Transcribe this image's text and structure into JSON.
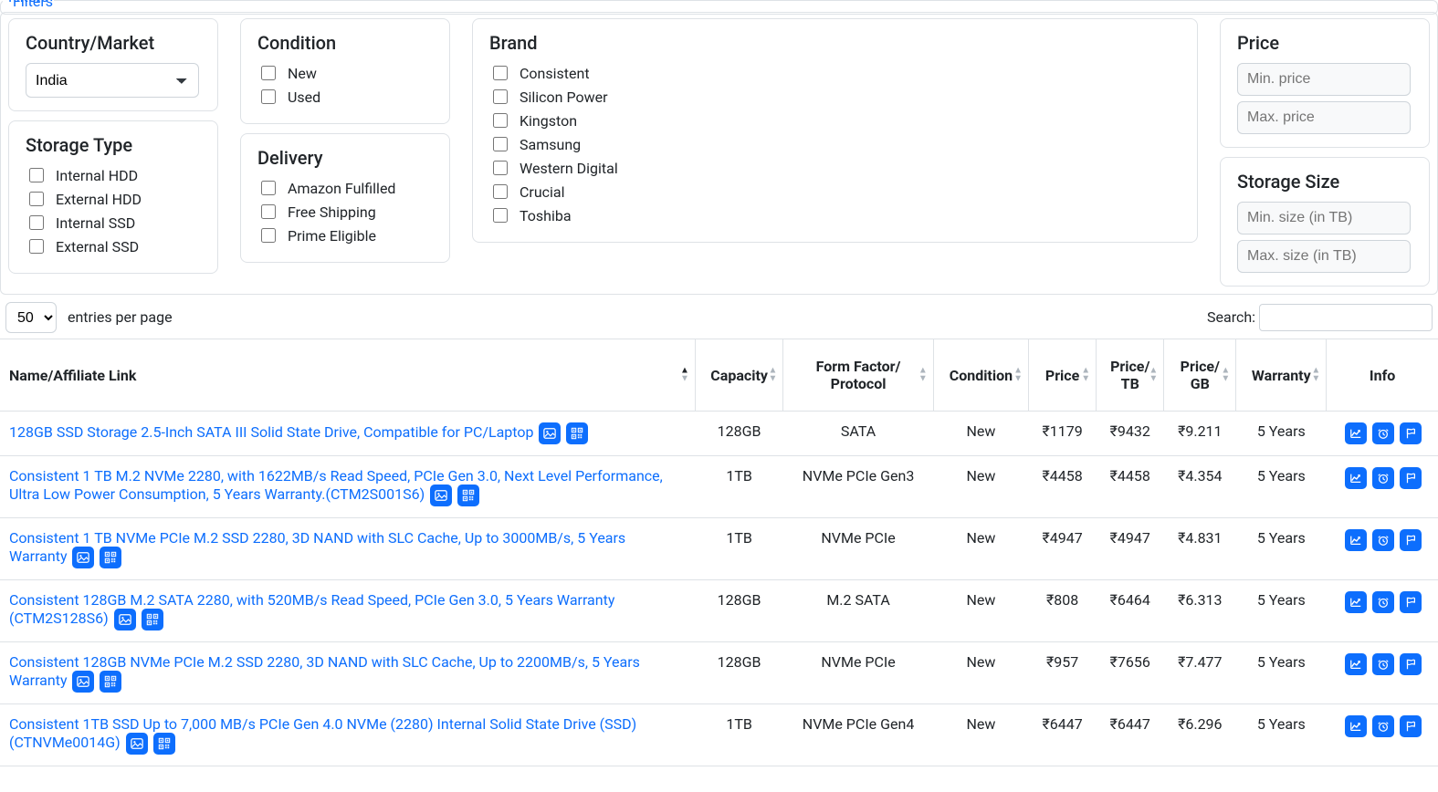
{
  "filters": {
    "link_text": "Filters",
    "country": {
      "title": "Country/Market",
      "selected": "India"
    },
    "storage_type": {
      "title": "Storage Type",
      "options": [
        "Internal HDD",
        "External HDD",
        "Internal SSD",
        "External SSD"
      ]
    },
    "condition": {
      "title": "Condition",
      "options": [
        "New",
        "Used"
      ]
    },
    "delivery": {
      "title": "Delivery",
      "options": [
        "Amazon Fulfilled",
        "Free Shipping",
        "Prime Eligible"
      ]
    },
    "brand": {
      "title": "Brand",
      "options": [
        "Consistent",
        "Silicon Power",
        "Kingston",
        "Samsung",
        "Western Digital",
        "Crucial",
        "Toshiba"
      ]
    },
    "price": {
      "title": "Price",
      "min_placeholder": "Min. price",
      "max_placeholder": "Max. price"
    },
    "storage_size": {
      "title": "Storage Size",
      "min_placeholder": "Min. size (in TB)",
      "max_placeholder": "Max. size (in TB)"
    }
  },
  "table_controls": {
    "entries_value": "50",
    "entries_label": "entries per page",
    "search_label": "Search:"
  },
  "columns": [
    "Name/Affiliate Link",
    "Capacity",
    "Form Factor/\nProtocol",
    "Condition",
    "Price",
    "Price/\nTB",
    "Price/\nGB",
    "Warranty",
    "Info"
  ],
  "rows": [
    {
      "name": "128GB SSD Storage 2.5-Inch SATA III Solid State Drive, Compatible for PC/Laptop",
      "capacity": "128GB",
      "form": "SATA",
      "condition": "New",
      "price": "₹1179",
      "price_tb": "₹9432",
      "price_gb": "₹9.211",
      "warranty": "5 Years"
    },
    {
      "name": "Consistent 1 TB M.2 NVMe 2280, with 1622MB/s Read Speed, PCIe Gen 3.0, Next Level Performance, Ultra Low Power Consumption, 5 Years Warranty.(CTM2S001S6)",
      "capacity": "1TB",
      "form": "NVMe PCIe Gen3",
      "condition": "New",
      "price": "₹4458",
      "price_tb": "₹4458",
      "price_gb": "₹4.354",
      "warranty": "5 Years"
    },
    {
      "name": "Consistent 1 TB NVMe PCIe M.2 SSD 2280, 3D NAND with SLC Cache, Up to 3000MB/s, 5 Years Warranty",
      "capacity": "1TB",
      "form": "NVMe PCIe",
      "condition": "New",
      "price": "₹4947",
      "price_tb": "₹4947",
      "price_gb": "₹4.831",
      "warranty": "5 Years"
    },
    {
      "name": "Consistent 128GB M.2 SATA 2280, with 520MB/s Read Speed, PCIe Gen 3.0, 5 Years Warranty (CTM2S128S6)",
      "capacity": "128GB",
      "form": "M.2 SATA",
      "condition": "New",
      "price": "₹808",
      "price_tb": "₹6464",
      "price_gb": "₹6.313",
      "warranty": "5 Years"
    },
    {
      "name": "Consistent 128GB NVMe PCIe M.2 SSD 2280, 3D NAND with SLC Cache, Up to 2200MB/s, 5 Years Warranty",
      "capacity": "128GB",
      "form": "NVMe PCIe",
      "condition": "New",
      "price": "₹957",
      "price_tb": "₹7656",
      "price_gb": "₹7.477",
      "warranty": "5 Years"
    },
    {
      "name": "Consistent 1TB SSD Up to 7,000 MB/s PCIe Gen 4.0 NVMe (2280) Internal Solid State Drive (SSD) (CTNVMe0014G)",
      "capacity": "1TB",
      "form": "NVMe PCIe Gen4",
      "condition": "New",
      "price": "₹6447",
      "price_tb": "₹6447",
      "price_gb": "₹6.296",
      "warranty": "5 Years"
    }
  ]
}
